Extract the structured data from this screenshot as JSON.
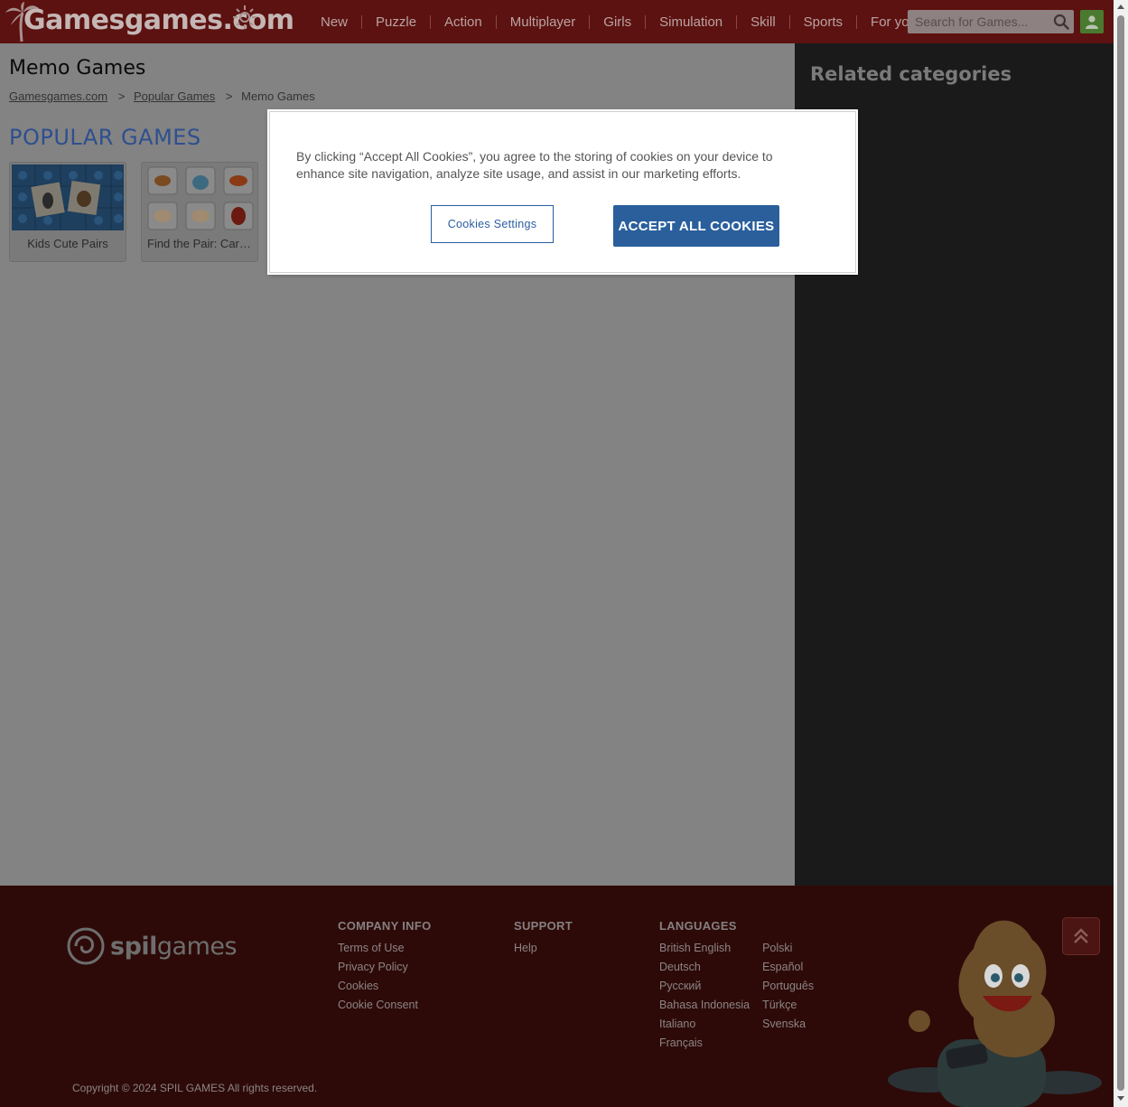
{
  "header": {
    "logo_text": "Gamesgames.com",
    "nav": [
      "New",
      "Puzzle",
      "Action",
      "Multiplayer",
      "Girls",
      "Simulation",
      "Skill",
      "Sports",
      "For you"
    ],
    "search_placeholder": "Search for Games..."
  },
  "main": {
    "title": "Memo Games",
    "breadcrumb": {
      "home": "Gamesgames.com",
      "parent": "Popular Games",
      "current": "Memo Games",
      "separator": ">"
    },
    "section_title": "POPULAR GAMES",
    "games": [
      {
        "name": "Kids Cute Pairs"
      },
      {
        "name": "Find the Pair: Cartoon"
      }
    ]
  },
  "sidebar": {
    "title": "Related categories"
  },
  "cookie_banner": {
    "text": "By clicking “Accept All Cookies”, you agree to the storing of cookies on your device to enhance site navigation, analyze site usage, and assist in our marketing efforts.",
    "settings_label": "Cookies Settings",
    "accept_label": "ACCEPT ALL COOKIES"
  },
  "footer": {
    "logo_text_bold": "spil",
    "logo_text_regular": "games",
    "company": {
      "heading": "COMPANY INFO",
      "links": [
        "Terms of Use",
        "Privacy Policy",
        "Cookies",
        "Cookie Consent"
      ]
    },
    "support": {
      "heading": "SUPPORT",
      "links": [
        "Help"
      ]
    },
    "languages": {
      "heading": "LANGUAGES",
      "col1": [
        "British English",
        "Deutsch",
        "Русский",
        "Bahasa Indonesia",
        "Italiano",
        "Français"
      ],
      "col2": [
        "Polski",
        "Español",
        "Português",
        "Türkçe",
        "Svenska"
      ]
    },
    "copyright": "Copyright © 2024 SPIL GAMES All rights reserved."
  },
  "colors": {
    "header_bg": "#5c1210",
    "accept_button": "#2a5f9c",
    "section_title": "#2e4f8f"
  }
}
